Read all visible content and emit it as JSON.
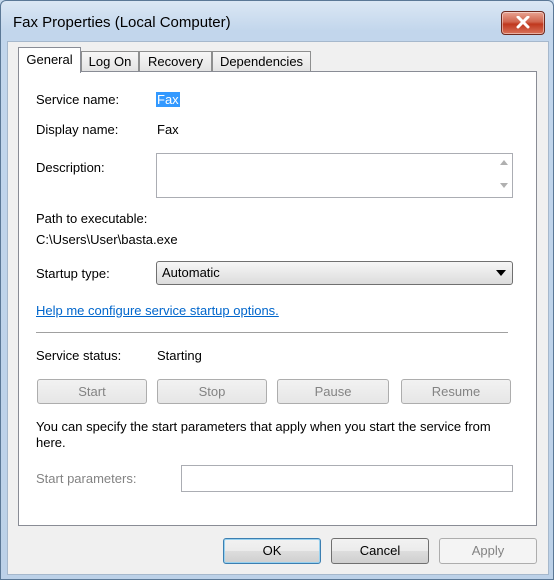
{
  "window": {
    "title": "Fax Properties (Local Computer)"
  },
  "tabs": [
    {
      "label": "General",
      "active": true
    },
    {
      "label": "Log On",
      "active": false
    },
    {
      "label": "Recovery",
      "active": false
    },
    {
      "label": "Dependencies",
      "active": false
    }
  ],
  "general": {
    "service_name_label": "Service name:",
    "service_name_value": "Fax",
    "display_name_label": "Display name:",
    "display_name_value": "Fax",
    "description_label": "Description:",
    "description_value": "",
    "path_label": "Path to executable:",
    "path_value": "C:\\Users\\User\\basta.exe",
    "startup_type_label": "Startup type:",
    "startup_type_value": "Automatic",
    "help_link": "Help me configure service startup options.",
    "status_label": "Service status:",
    "status_value": "Starting",
    "buttons": {
      "start": "Start",
      "stop": "Stop",
      "pause": "Pause",
      "resume": "Resume"
    },
    "params_note": "You can specify the start parameters that apply when you start the service from here.",
    "params_label": "Start parameters:",
    "params_value": ""
  },
  "footer": {
    "ok": "OK",
    "cancel": "Cancel",
    "apply": "Apply"
  },
  "colors": {
    "selection": "#3399ff",
    "link": "#0066cc",
    "close_button": "#c0381e"
  }
}
